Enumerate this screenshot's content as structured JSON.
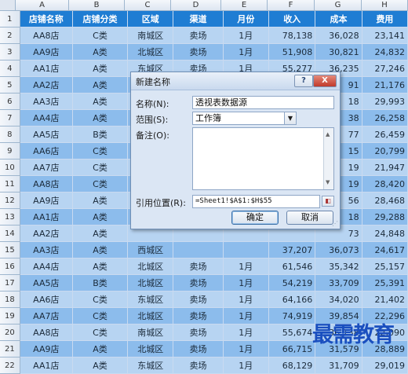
{
  "columns": [
    "A",
    "B",
    "C",
    "D",
    "E",
    "F",
    "G",
    "H"
  ],
  "headers": [
    "店铺名称",
    "店铺分类",
    "区域",
    "渠道",
    "月份",
    "收入",
    "成本",
    "费用"
  ],
  "rows": [
    [
      "AA8店",
      "C类",
      "南城区",
      "卖场",
      "1月",
      "78,138",
      "36,028",
      "23,141"
    ],
    [
      "AA9店",
      "A类",
      "北城区",
      "卖场",
      "1月",
      "51,908",
      "30,821",
      "24,832"
    ],
    [
      "AA1店",
      "A类",
      "东城区",
      "卖场",
      "1月",
      "55,277",
      "36,235",
      "27,246"
    ],
    [
      "AA2店",
      "A类",
      "",
      "",
      "",
      "",
      "91",
      "21,176"
    ],
    [
      "AA3店",
      "A类",
      "",
      "",
      "",
      "",
      "18",
      "29,993"
    ],
    [
      "AA4店",
      "A类",
      "",
      "",
      "",
      "",
      "38",
      "26,258"
    ],
    [
      "AA5店",
      "B类",
      "",
      "",
      "",
      "",
      "77",
      "26,459"
    ],
    [
      "AA6店",
      "C类",
      "",
      "",
      "",
      "",
      "15",
      "20,799"
    ],
    [
      "AA7店",
      "C类",
      "",
      "",
      "",
      "",
      "19",
      "21,947"
    ],
    [
      "AA8店",
      "C类",
      "",
      "",
      "",
      "",
      "19",
      "28,420"
    ],
    [
      "AA9店",
      "A类",
      "",
      "",
      "",
      "",
      "56",
      "28,468"
    ],
    [
      "AA1店",
      "A类",
      "",
      "",
      "",
      "",
      "18",
      "29,288"
    ],
    [
      "AA2店",
      "A类",
      "",
      "",
      "",
      "",
      "73",
      "24,848"
    ],
    [
      "AA3店",
      "A类",
      "西城区",
      "",
      "",
      "37,207",
      "36,073",
      "24,617"
    ],
    [
      "AA4店",
      "A类",
      "北城区",
      "卖场",
      "1月",
      "61,546",
      "35,342",
      "25,157"
    ],
    [
      "AA5店",
      "B类",
      "北城区",
      "卖场",
      "1月",
      "54,219",
      "33,709",
      "25,391"
    ],
    [
      "AA6店",
      "C类",
      "东城区",
      "卖场",
      "1月",
      "64,166",
      "34,020",
      "21,402"
    ],
    [
      "AA7店",
      "C类",
      "北城区",
      "卖场",
      "1月",
      "74,919",
      "39,854",
      "22,296"
    ],
    [
      "AA8店",
      "C类",
      "南城区",
      "卖场",
      "1月",
      "55,674",
      "36,138",
      "22,090"
    ],
    [
      "AA9店",
      "A类",
      "北城区",
      "卖场",
      "1月",
      "66,715",
      "31,579",
      "28,889"
    ],
    [
      "AA1店",
      "A类",
      "东城区",
      "卖场",
      "1月",
      "68,129",
      "31,709",
      "29,019"
    ]
  ],
  "dialog": {
    "title": "新建名称",
    "help": "?",
    "close": "X",
    "name_label": "名称(N):",
    "name_value": "透视表数据源",
    "scope_label": "范围(S):",
    "scope_value": "工作簿",
    "comment_label": "备注(O):",
    "comment_value": "",
    "ref_label": "引用位置(R):",
    "ref_value": "=Sheet1!$A$1:$H$55",
    "ok": "确定",
    "cancel": "取消"
  },
  "watermark": "最需教育"
}
